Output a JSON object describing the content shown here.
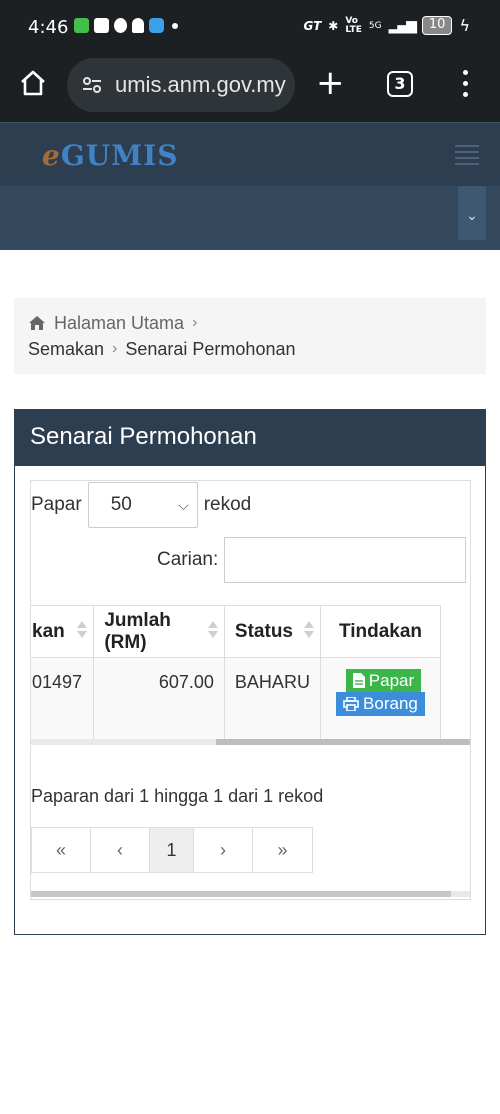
{
  "status_bar": {
    "time": "4:46",
    "network": "5G",
    "battery": "10"
  },
  "browser": {
    "url": "umis.anm.gov.my",
    "tab_count": "3"
  },
  "app": {
    "logo_e": "e",
    "logo_rest": "GUMIS"
  },
  "breadcrumb": {
    "home": "Halaman Utama",
    "level1": "Semakan",
    "level2": "Senarai Permohonan"
  },
  "panel": {
    "title": "Senarai Permohonan",
    "length_prefix": "Papar",
    "length_value": "50",
    "length_suffix": "rekod",
    "search_label": "Carian:",
    "search_value": ""
  },
  "table": {
    "headers": [
      "kan",
      "Jumlah (RM)",
      "Status",
      "Tindakan"
    ],
    "rows": [
      {
        "col1": "01497",
        "amount": "607.00",
        "status": "BAHARU",
        "btn_view": "Papar",
        "btn_print": "Borang"
      }
    ]
  },
  "footer": {
    "info": "Paparan dari 1 hingga 1 dari 1 rekod",
    "first": "«",
    "prev": "‹",
    "current_page": "1",
    "next": "›",
    "last": "»"
  }
}
